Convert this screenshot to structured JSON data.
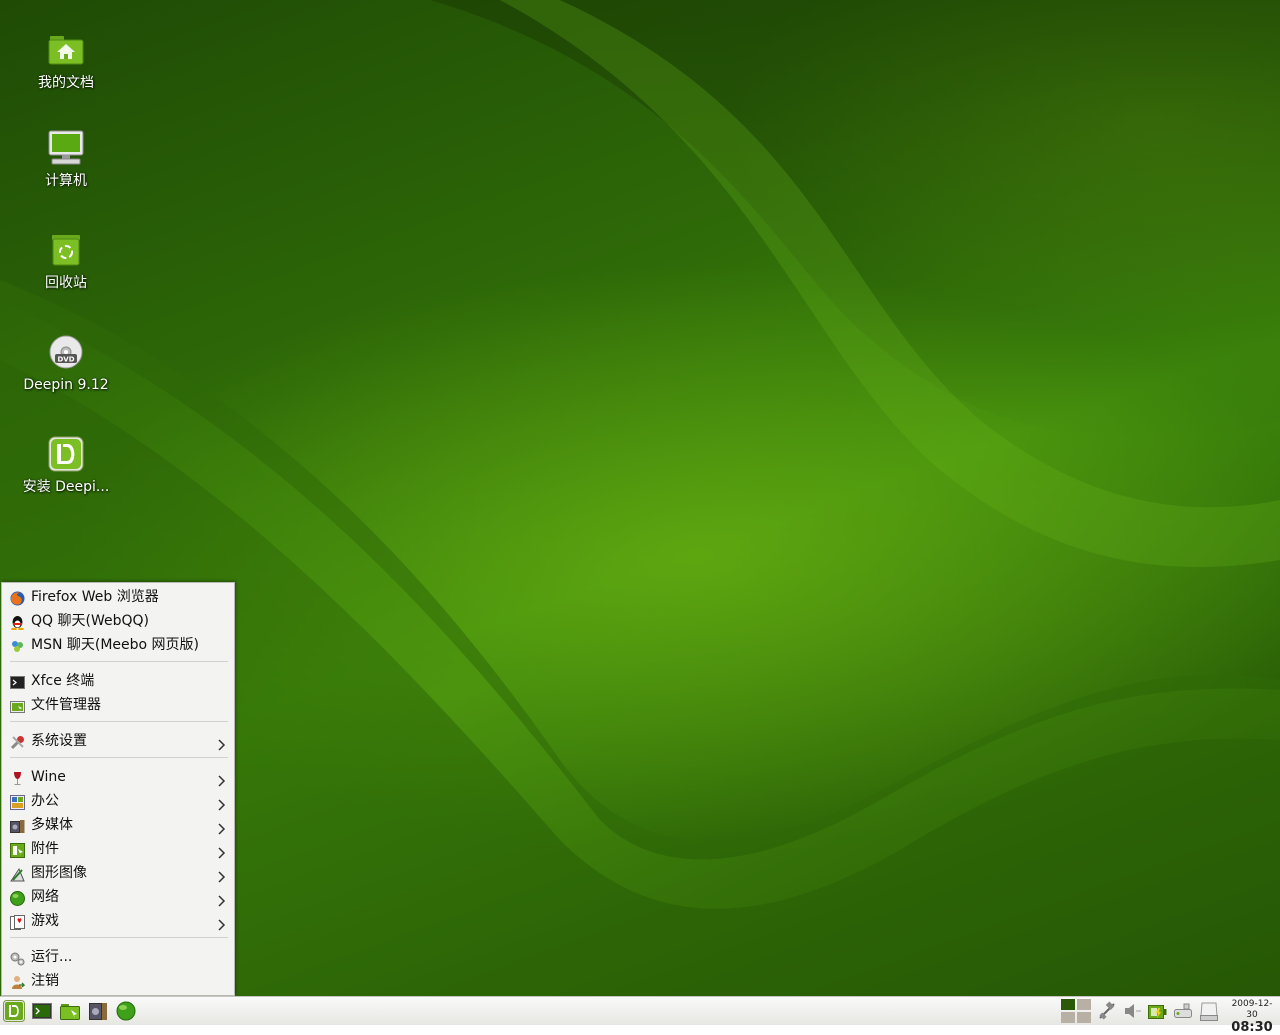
{
  "desktop": {
    "icons": [
      {
        "label": "我的文档",
        "icon": "home-folder-icon"
      },
      {
        "label": "计算机",
        "icon": "computer-icon"
      },
      {
        "label": "回收站",
        "icon": "trash-icon"
      },
      {
        "label": "Deepin 9.12",
        "icon": "dvd-icon"
      },
      {
        "label": "安装 Deepi...",
        "icon": "deepin-logo-icon"
      }
    ]
  },
  "start_menu": {
    "items": [
      {
        "label": "Firefox Web 浏览器",
        "icon": "firefox-icon",
        "submenu": false
      },
      {
        "label": "QQ 聊天(WebQQ)",
        "icon": "qq-penguin-icon",
        "submenu": false
      },
      {
        "label": "MSN 聊天(Meebo 网页版)",
        "icon": "msn-icon",
        "submenu": false
      },
      {
        "label": "Xfce 终端",
        "icon": "terminal-icon",
        "submenu": false
      },
      {
        "label": "文件管理器",
        "icon": "file-manager-icon",
        "submenu": false
      },
      {
        "label": "系统设置",
        "icon": "settings-icon",
        "submenu": true
      },
      {
        "label": "Wine",
        "icon": "wine-glass-icon",
        "submenu": true
      },
      {
        "label": "办公",
        "icon": "office-icon",
        "submenu": true
      },
      {
        "label": "多媒体",
        "icon": "multimedia-icon",
        "submenu": true
      },
      {
        "label": "附件",
        "icon": "accessories-icon",
        "submenu": true
      },
      {
        "label": "图形图像",
        "icon": "graphics-icon",
        "submenu": true
      },
      {
        "label": "网络",
        "icon": "network-globe-icon",
        "submenu": true
      },
      {
        "label": "游戏",
        "icon": "games-icon",
        "submenu": true
      },
      {
        "label": "运行...",
        "icon": "run-gears-icon",
        "submenu": false
      },
      {
        "label": "注销",
        "icon": "logout-icon",
        "submenu": false
      }
    ]
  },
  "taskbar": {
    "launchers": [
      "deepin-menu-button",
      "terminal-launcher",
      "file-manager-launcher",
      "media-player-launcher",
      "browser-globe-launcher"
    ],
    "tray": [
      "workspace-switcher",
      "network-tray-icon",
      "volume-icon",
      "battery-icon",
      "removable-drive-icon",
      "hard-disk-icon"
    ],
    "clock_date": "2009-12-30",
    "clock_time": "08:30"
  },
  "colors": {
    "accent": "#3f8a0c",
    "menu_bg": "#f3f3f1",
    "taskbar_bg": "#ecece8"
  }
}
